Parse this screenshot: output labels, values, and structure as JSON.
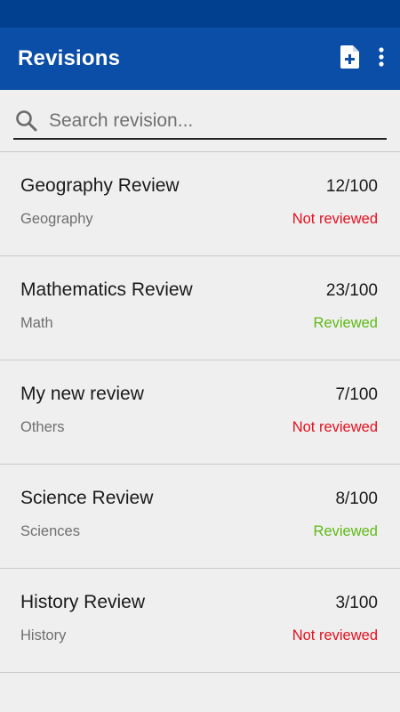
{
  "app_bar": {
    "title": "Revisions",
    "icons": [
      "new-document-icon",
      "more-vert-icon"
    ]
  },
  "search": {
    "placeholder": "Search revision...",
    "value": ""
  },
  "colors": {
    "status_bar": "#01408f",
    "app_bar": "#0a4ea8",
    "not_reviewed": "#e3101e",
    "reviewed": "#5fba16"
  },
  "revisions": [
    {
      "title": "Geography Review",
      "category": "Geography",
      "score": "12/100",
      "status": "Not reviewed",
      "reviewed": false
    },
    {
      "title": "Mathematics Review",
      "category": "Math",
      "score": "23/100",
      "status": "Reviewed",
      "reviewed": true
    },
    {
      "title": "My new review",
      "category": "Others",
      "score": "7/100",
      "status": "Not reviewed",
      "reviewed": false
    },
    {
      "title": "Science Review",
      "category": "Sciences",
      "score": "8/100",
      "status": "Reviewed",
      "reviewed": true
    },
    {
      "title": "History Review",
      "category": "History",
      "score": "3/100",
      "status": "Not reviewed",
      "reviewed": false
    }
  ]
}
